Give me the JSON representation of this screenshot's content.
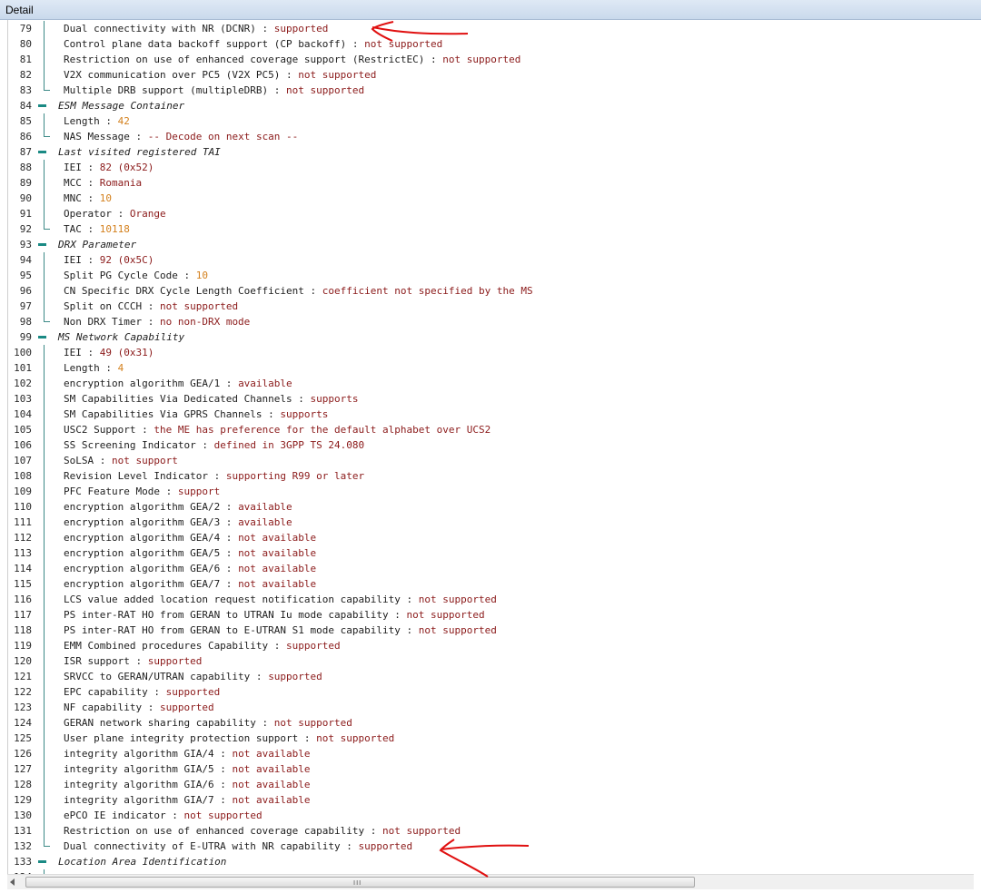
{
  "window": {
    "title": "Detail"
  },
  "annotation_color": "#e01010",
  "rows": [
    {
      "n": "79",
      "t": "item",
      "label": "Dual connectivity with NR (DCNR)",
      "value": "supported",
      "kind": "text"
    },
    {
      "n": "80",
      "t": "item",
      "label": "Control plane data backoff support (CP backoff)",
      "value": "not supported",
      "kind": "text"
    },
    {
      "n": "81",
      "t": "item",
      "label": "Restriction on use of enhanced coverage support (RestrictEC)",
      "value": "not supported",
      "kind": "text"
    },
    {
      "n": "82",
      "t": "item",
      "label": "V2X communication over PC5 (V2X PC5)",
      "value": "not supported",
      "kind": "text"
    },
    {
      "n": "83",
      "t": "last",
      "label": "Multiple DRB support (multipleDRB)",
      "value": "not supported",
      "kind": "text"
    },
    {
      "n": "84",
      "t": "header",
      "label": "ESM Message Container"
    },
    {
      "n": "85",
      "t": "item",
      "label": "Length",
      "value": "42",
      "kind": "num"
    },
    {
      "n": "86",
      "t": "last",
      "label": "NAS Message",
      "value": "-- Decode on next scan --",
      "kind": "text"
    },
    {
      "n": "87",
      "t": "header",
      "label": "Last visited registered TAI"
    },
    {
      "n": "88",
      "t": "item",
      "label": "IEI",
      "value": "82 (0x52)",
      "kind": "text"
    },
    {
      "n": "89",
      "t": "item",
      "label": "MCC",
      "value": "Romania",
      "kind": "text"
    },
    {
      "n": "90",
      "t": "item",
      "label": "MNC",
      "value": "10",
      "kind": "num"
    },
    {
      "n": "91",
      "t": "item",
      "label": "Operator",
      "value": "Orange",
      "kind": "text"
    },
    {
      "n": "92",
      "t": "last",
      "label": "TAC",
      "value": "10118",
      "kind": "num"
    },
    {
      "n": "93",
      "t": "header",
      "label": "DRX Parameter"
    },
    {
      "n": "94",
      "t": "item",
      "label": "IEI",
      "value": "92 (0x5C)",
      "kind": "text"
    },
    {
      "n": "95",
      "t": "item",
      "label": "Split PG Cycle Code",
      "value": "10",
      "kind": "num"
    },
    {
      "n": "96",
      "t": "item",
      "label": "CN Specific DRX Cycle Length Coefficient",
      "value": "coefficient not specified by the MS",
      "kind": "text"
    },
    {
      "n": "97",
      "t": "item",
      "label": "Split on CCCH",
      "value": "not supported",
      "kind": "text"
    },
    {
      "n": "98",
      "t": "last",
      "label": "Non DRX Timer",
      "value": "no non-DRX mode",
      "kind": "text"
    },
    {
      "n": "99",
      "t": "header",
      "label": "MS Network Capability"
    },
    {
      "n": "100",
      "t": "item",
      "label": "IEI",
      "value": "49 (0x31)",
      "kind": "text"
    },
    {
      "n": "101",
      "t": "item",
      "label": "Length",
      "value": "4",
      "kind": "num"
    },
    {
      "n": "102",
      "t": "item",
      "label": "encryption algorithm GEA/1",
      "value": "available",
      "kind": "text"
    },
    {
      "n": "103",
      "t": "item",
      "label": "SM Capabilities Via Dedicated Channels",
      "value": "supports",
      "kind": "text"
    },
    {
      "n": "104",
      "t": "item",
      "label": "SM Capabilities Via GPRS Channels",
      "value": "supports",
      "kind": "text"
    },
    {
      "n": "105",
      "t": "item",
      "label": "USC2 Support",
      "value": "the ME has preference for the default alphabet over UCS2",
      "kind": "text"
    },
    {
      "n": "106",
      "t": "item",
      "label": "SS Screening Indicator",
      "value": "defined in 3GPP TS 24.080",
      "kind": "text"
    },
    {
      "n": "107",
      "t": "item",
      "label": "SoLSA",
      "value": "not support",
      "kind": "text"
    },
    {
      "n": "108",
      "t": "item",
      "label": "Revision Level Indicator",
      "value": "supporting R99 or later",
      "kind": "text"
    },
    {
      "n": "109",
      "t": "item",
      "label": "PFC Feature Mode",
      "value": "support",
      "kind": "text"
    },
    {
      "n": "110",
      "t": "item",
      "label": "encryption algorithm GEA/2",
      "value": "available",
      "kind": "text"
    },
    {
      "n": "111",
      "t": "item",
      "label": "encryption algorithm GEA/3",
      "value": "available",
      "kind": "text"
    },
    {
      "n": "112",
      "t": "item",
      "label": "encryption algorithm GEA/4",
      "value": "not available",
      "kind": "text"
    },
    {
      "n": "113",
      "t": "item",
      "label": "encryption algorithm GEA/5",
      "value": "not available",
      "kind": "text"
    },
    {
      "n": "114",
      "t": "item",
      "label": "encryption algorithm GEA/6",
      "value": "not available",
      "kind": "text"
    },
    {
      "n": "115",
      "t": "item",
      "label": "encryption algorithm GEA/7",
      "value": "not available",
      "kind": "text"
    },
    {
      "n": "116",
      "t": "item",
      "label": "LCS value added location request notification capability",
      "value": "not supported",
      "kind": "text"
    },
    {
      "n": "117",
      "t": "item",
      "label": "PS inter-RAT HO from GERAN to UTRAN Iu mode capability",
      "value": "not supported",
      "kind": "text"
    },
    {
      "n": "118",
      "t": "item",
      "label": "PS inter-RAT HO from GERAN to E-UTRAN S1 mode capability",
      "value": "not supported",
      "kind": "text"
    },
    {
      "n": "119",
      "t": "item",
      "label": "EMM Combined procedures Capability",
      "value": "supported",
      "kind": "text"
    },
    {
      "n": "120",
      "t": "item",
      "label": "ISR support",
      "value": "supported",
      "kind": "text"
    },
    {
      "n": "121",
      "t": "item",
      "label": "SRVCC to GERAN/UTRAN capability",
      "value": "supported",
      "kind": "text"
    },
    {
      "n": "122",
      "t": "item",
      "label": "EPC capability",
      "value": "supported",
      "kind": "text"
    },
    {
      "n": "123",
      "t": "item",
      "label": "NF capability",
      "value": "supported",
      "kind": "text"
    },
    {
      "n": "124",
      "t": "item",
      "label": "GERAN network sharing capability",
      "value": "not supported",
      "kind": "text"
    },
    {
      "n": "125",
      "t": "item",
      "label": "User plane integrity protection support",
      "value": "not supported",
      "kind": "text"
    },
    {
      "n": "126",
      "t": "item",
      "label": "integrity algorithm GIA/4",
      "value": "not available",
      "kind": "text"
    },
    {
      "n": "127",
      "t": "item",
      "label": "integrity algorithm GIA/5",
      "value": "not available",
      "kind": "text"
    },
    {
      "n": "128",
      "t": "item",
      "label": "integrity algorithm GIA/6",
      "value": "not available",
      "kind": "text"
    },
    {
      "n": "129",
      "t": "item",
      "label": "integrity algorithm GIA/7",
      "value": "not available",
      "kind": "text"
    },
    {
      "n": "130",
      "t": "item",
      "label": "ePCO IE indicator",
      "value": "not supported",
      "kind": "text"
    },
    {
      "n": "131",
      "t": "item",
      "label": "Restriction on use of enhanced coverage capability",
      "value": "not supported",
      "kind": "text"
    },
    {
      "n": "132",
      "t": "last",
      "label": "Dual connectivity of E-UTRA with NR capability",
      "value": "supported",
      "kind": "text"
    },
    {
      "n": "133",
      "t": "header",
      "label": "Location Area Identification"
    },
    {
      "n": "134",
      "t": "item",
      "label": "",
      "value": "",
      "kind": "text"
    }
  ],
  "separator": " : ",
  "scrollbar": {
    "grip": "III"
  }
}
